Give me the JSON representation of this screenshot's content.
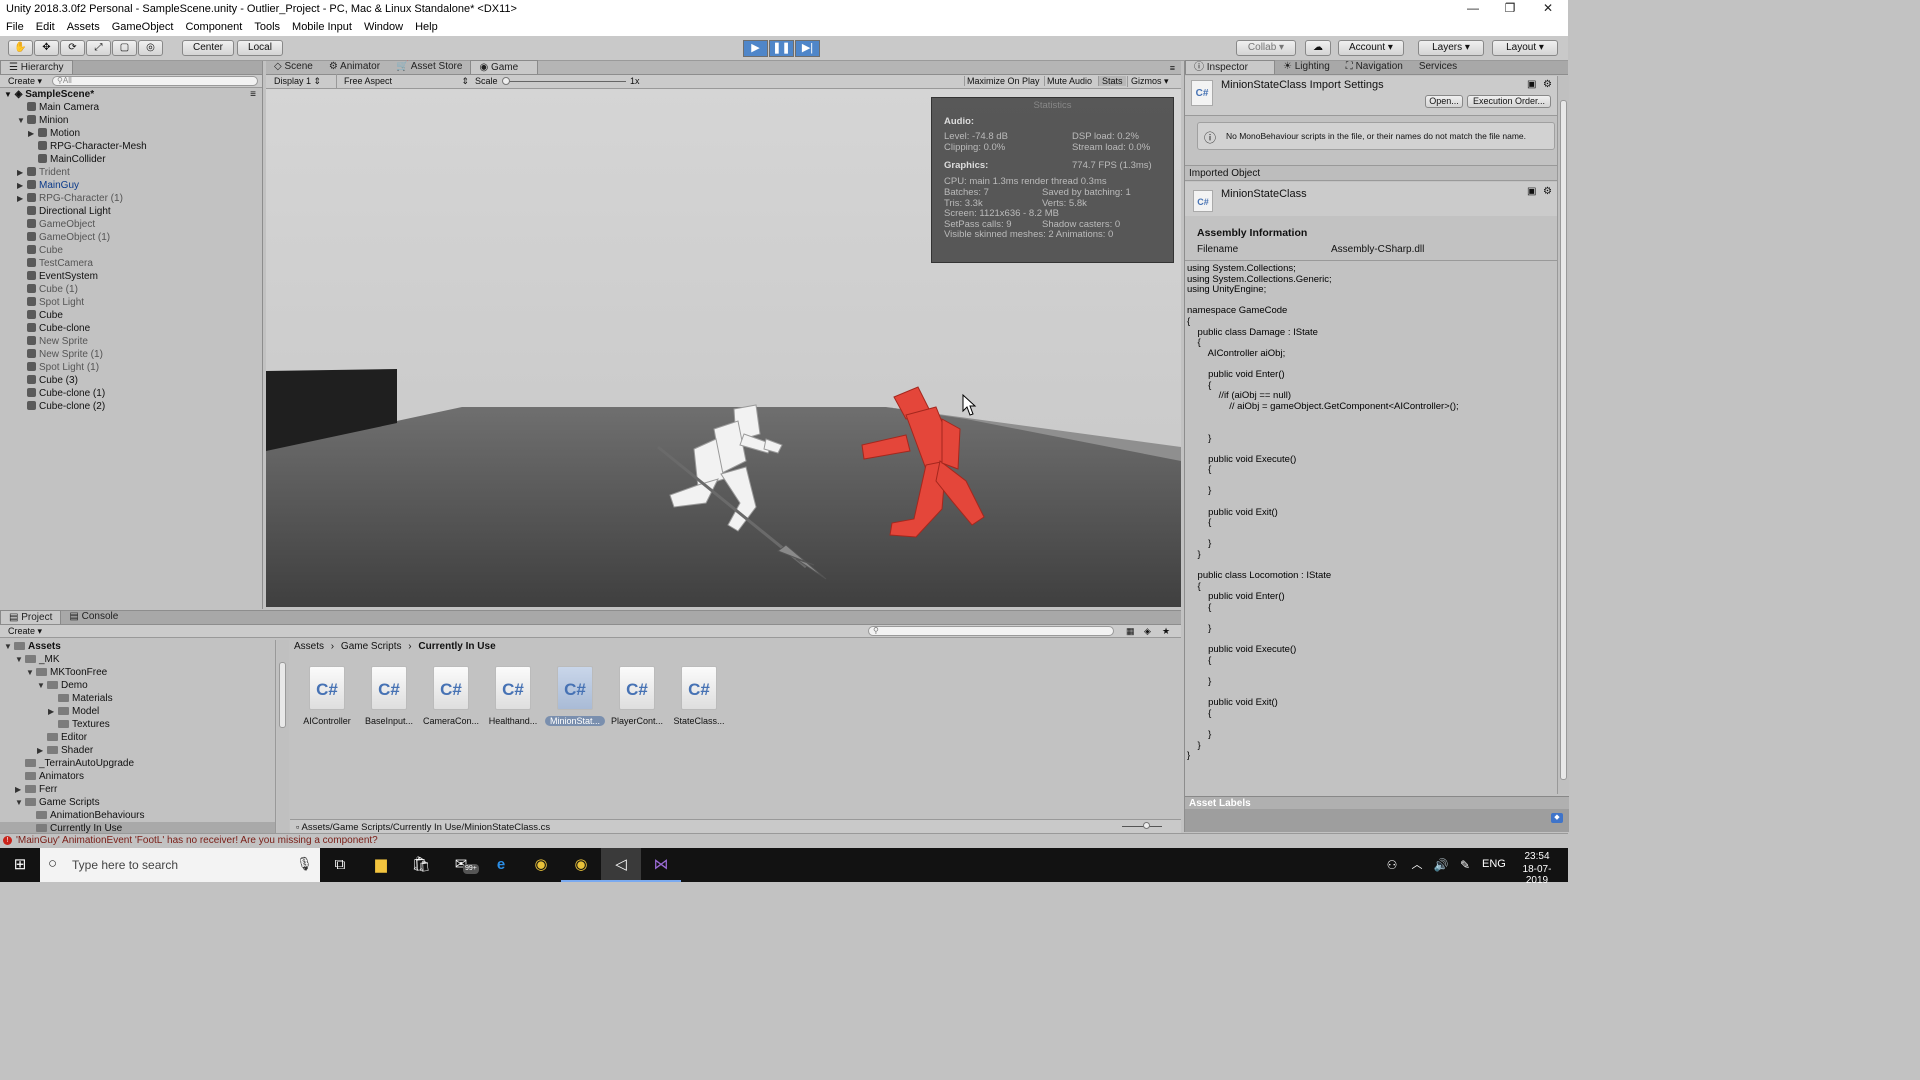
{
  "window": {
    "title": "Unity 2018.3.0f2 Personal - SampleScene.unity - Outlier_Project - PC, Mac & Linux Standalone* <DX11>"
  },
  "menu": [
    "File",
    "Edit",
    "Assets",
    "GameObject",
    "Component",
    "Tools",
    "Mobile Input",
    "Window",
    "Help"
  ],
  "toolbar": {
    "center": "Center",
    "local": "Local",
    "collab": "Collab",
    "account": "Account",
    "layers": "Layers",
    "layout": "Layout"
  },
  "hierarchy": {
    "tab": "Hierarchy",
    "create": "Create",
    "search_placeholder": "All",
    "scene": "SampleScene*",
    "items": [
      {
        "label": "Main Camera",
        "indent": 1,
        "tri": "",
        "style": "normal"
      },
      {
        "label": "Minion",
        "indent": 1,
        "tri": "▼",
        "style": "normal"
      },
      {
        "label": "Motion",
        "indent": 2,
        "tri": "▶",
        "style": "normal"
      },
      {
        "label": "RPG-Character-Mesh",
        "indent": 2,
        "tri": "",
        "style": "normal"
      },
      {
        "label": "MainCollider",
        "indent": 2,
        "tri": "",
        "style": "normal"
      },
      {
        "label": "Trident",
        "indent": 1,
        "tri": "▶",
        "style": "dim"
      },
      {
        "label": "MainGuy",
        "indent": 1,
        "tri": "▶",
        "style": "prefab"
      },
      {
        "label": "RPG-Character (1)",
        "indent": 1,
        "tri": "▶",
        "style": "dim"
      },
      {
        "label": "Directional Light",
        "indent": 1,
        "tri": "",
        "style": "normal"
      },
      {
        "label": "GameObject",
        "indent": 1,
        "tri": "",
        "style": "dim"
      },
      {
        "label": "GameObject (1)",
        "indent": 1,
        "tri": "",
        "style": "dim"
      },
      {
        "label": "Cube",
        "indent": 1,
        "tri": "",
        "style": "dim"
      },
      {
        "label": "TestCamera",
        "indent": 1,
        "tri": "",
        "style": "dim"
      },
      {
        "label": "EventSystem",
        "indent": 1,
        "tri": "",
        "style": "normal"
      },
      {
        "label": "Cube (1)",
        "indent": 1,
        "tri": "",
        "style": "dim"
      },
      {
        "label": "Spot Light",
        "indent": 1,
        "tri": "",
        "style": "dim"
      },
      {
        "label": "Cube",
        "indent": 1,
        "tri": "",
        "style": "normal"
      },
      {
        "label": "Cube-clone",
        "indent": 1,
        "tri": "",
        "style": "normal"
      },
      {
        "label": "New Sprite",
        "indent": 1,
        "tri": "",
        "style": "dim"
      },
      {
        "label": "New Sprite (1)",
        "indent": 1,
        "tri": "",
        "style": "dim"
      },
      {
        "label": "Spot Light (1)",
        "indent": 1,
        "tri": "",
        "style": "dim"
      },
      {
        "label": "Cube (3)",
        "indent": 1,
        "tri": "",
        "style": "normal"
      },
      {
        "label": "Cube-clone (1)",
        "indent": 1,
        "tri": "",
        "style": "normal"
      },
      {
        "label": "Cube-clone (2)",
        "indent": 1,
        "tri": "",
        "style": "normal"
      }
    ]
  },
  "center_tabs": [
    "Scene",
    "Animator",
    "Asset Store",
    "Game"
  ],
  "game": {
    "display": "Display 1",
    "aspect": "Free Aspect",
    "scale_label": "Scale",
    "scale_value": "1x",
    "maximize": "Maximize On Play",
    "mute": "Mute Audio",
    "stats": "Stats",
    "gizmos": "Gizmos"
  },
  "statistics": {
    "title": "Statistics",
    "audio_header": "Audio:",
    "level": "Level: -74.8 dB",
    "clipping": "Clipping: 0.0%",
    "dsp": "DSP load: 0.2%",
    "stream": "Stream load: 0.0%",
    "graphics_header": "Graphics:",
    "fps": "774.7 FPS (1.3ms)",
    "cpu": "CPU: main 1.3ms  render thread 0.3ms",
    "batches": "Batches: 7",
    "saved": "Saved by batching: 1",
    "tris": "Tris: 3.3k",
    "verts": "Verts: 5.8k",
    "screen": "Screen: 1121x636 - 8.2 MB",
    "setpass": "SetPass calls: 9",
    "shadow": "Shadow casters: 0",
    "visible": "Visible skinned meshes: 2  Animations: 0"
  },
  "inspector_tabs": [
    "Inspector",
    "Lighting",
    "Navigation",
    "Services"
  ],
  "inspector": {
    "title": "MinionStateClass Import Settings",
    "open": "Open...",
    "exec": "Execution Order...",
    "warning": "No MonoBehaviour scripts in the file, or their names do not match the file name.",
    "imported_object": "Imported Object",
    "object_name": "MinionStateClass",
    "assembly_header": "Assembly Information",
    "filename_label": "Filename",
    "filename_value": "Assembly-CSharp.dll",
    "code": "using System.Collections;\nusing System.Collections.Generic;\nusing UnityEngine;\n\nnamespace GameCode\n{\n    public class Damage : IState\n    {\n        AIController aiObj;\n\n        public void Enter()\n        {\n            //if (aiObj == null)\n                // aiObj = gameObject.GetComponent<AIController>();\n\n\n        }\n\n        public void Execute()\n        {\n\n        }\n\n        public void Exit()\n        {\n\n        }\n    }\n\n    public class Locomotion : IState\n    {\n        public void Enter()\n        {\n\n        }\n\n        public void Execute()\n        {\n\n        }\n\n        public void Exit()\n        {\n\n        }\n    }\n}",
    "asset_labels": "Asset Labels"
  },
  "project": {
    "tabs": [
      "Project",
      "Console"
    ],
    "create": "Create",
    "breadcrumb": [
      "Assets",
      "Game Scripts",
      "Currently In Use"
    ],
    "tree": [
      {
        "label": "Assets",
        "indent": 0,
        "tri": "▼",
        "bold": true
      },
      {
        "label": "_MK",
        "indent": 1,
        "tri": "▼",
        "bold": false
      },
      {
        "label": "MKToonFree",
        "indent": 2,
        "tri": "▼",
        "bold": false
      },
      {
        "label": "Demo",
        "indent": 3,
        "tri": "▼",
        "bold": false
      },
      {
        "label": "Materials",
        "indent": 4,
        "tri": "",
        "bold": false
      },
      {
        "label": "Model",
        "indent": 4,
        "tri": "▶",
        "bold": false
      },
      {
        "label": "Textures",
        "indent": 4,
        "tri": "",
        "bold": false
      },
      {
        "label": "Editor",
        "indent": 3,
        "tri": "",
        "bold": false
      },
      {
        "label": "Shader",
        "indent": 3,
        "tri": "▶",
        "bold": false
      },
      {
        "label": "_TerrainAutoUpgrade",
        "indent": 1,
        "tri": "",
        "bold": false
      },
      {
        "label": "Animators",
        "indent": 1,
        "tri": "",
        "bold": false
      },
      {
        "label": "Ferr",
        "indent": 1,
        "tri": "▶",
        "bold": false
      },
      {
        "label": "Game Scripts",
        "indent": 1,
        "tri": "▼",
        "bold": false
      },
      {
        "label": "AnimationBehaviours",
        "indent": 2,
        "tri": "",
        "bold": false
      },
      {
        "label": "Currently In Use",
        "indent": 2,
        "tri": "",
        "bold": false
      }
    ],
    "assets": [
      "AIController",
      "BaseInput...",
      "CameraCon...",
      "Healthand...",
      "MinionStat...",
      "PlayerCont...",
      "StateClass..."
    ],
    "asset_glyph": "C#",
    "path": "Assets/Game Scripts/Currently In Use/MinionStateClass.cs"
  },
  "status": {
    "message": "'MainGuy' AnimationEvent 'FootL' has no receiver! Are you missing a component?"
  },
  "taskbar": {
    "search_placeholder": "Type here to search",
    "badge": "99+",
    "lang": "ENG",
    "time": "23:54",
    "date": "18-07-2019"
  }
}
